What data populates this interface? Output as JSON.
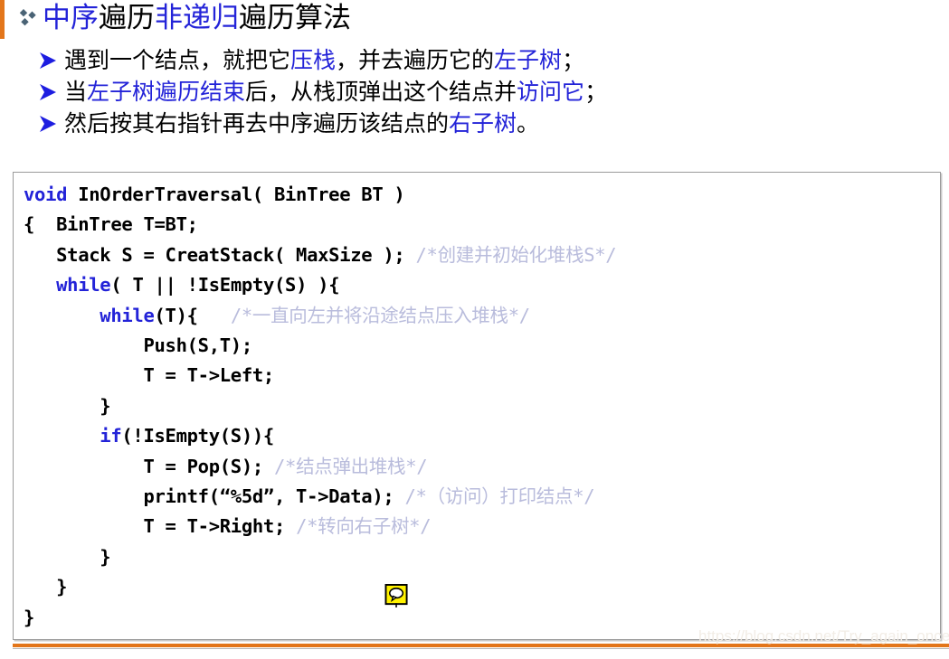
{
  "colors": {
    "accent_orange": "#E3761B",
    "highlight_blue": "#2323D8",
    "keyword_blue": "#2323D8",
    "comment_lavender": "#B9BCDC",
    "code_box_border": "#9A9A9A",
    "diamond_bullet": "#4A6375",
    "watermark": "#F2EDE6"
  },
  "heading": {
    "bullet_icon": "diamond-cluster-icon",
    "segments": [
      {
        "text": "中序",
        "highlight": true
      },
      {
        "text": "遍历",
        "highlight": false
      },
      {
        "text": "非递归",
        "highlight": true
      },
      {
        "text": "遍历算法",
        "highlight": false
      }
    ],
    "plain": "中序遍历非递归遍历算法"
  },
  "bullets": [
    {
      "icon": "arrow-bullet-icon",
      "segments": [
        {
          "text": "遇到一个结点，就把它",
          "highlight": false
        },
        {
          "text": "压栈",
          "highlight": true
        },
        {
          "text": "，并去遍历它的",
          "highlight": false
        },
        {
          "text": "左子树",
          "highlight": true
        },
        {
          "text": "；",
          "highlight": false
        }
      ],
      "plain": "遇到一个结点，就把它压栈，并去遍历它的左子树；"
    },
    {
      "icon": "arrow-bullet-icon",
      "segments": [
        {
          "text": "当",
          "highlight": false
        },
        {
          "text": "左子树遍历结束",
          "highlight": true
        },
        {
          "text": "后，从栈顶弹出这个结点并",
          "highlight": false
        },
        {
          "text": "访问它",
          "highlight": true
        },
        {
          "text": "；",
          "highlight": false
        }
      ],
      "plain": "当左子树遍历结束后，从栈顶弹出这个结点并访问它；"
    },
    {
      "icon": "arrow-bullet-icon",
      "segments": [
        {
          "text": "然后按其右指针再去中序遍历该结点的",
          "highlight": false
        },
        {
          "text": "右子树",
          "highlight": true
        },
        {
          "text": "。",
          "highlight": false
        }
      ],
      "plain": "然后按其右指针再去中序遍历该结点的右子树。"
    }
  ],
  "code_box": {
    "language": "C",
    "comment_marker": {
      "icon": "speech-bubble-comment-icon",
      "fill": "#FFF200",
      "border": "#000000"
    },
    "lines": [
      [
        {
          "t": "void",
          "c": "kw"
        },
        {
          "t": " InOrderTraversal( BinTree BT )",
          "c": ""
        }
      ],
      [
        {
          "t": "{  BinTree T=BT;",
          "c": ""
        }
      ],
      [
        {
          "t": "   Stack S = CreatStack( MaxSize ); ",
          "c": ""
        },
        {
          "t": "/*创建并初始化堆栈S*/",
          "c": "cmt"
        }
      ],
      [
        {
          "t": "   ",
          "c": ""
        },
        {
          "t": "while",
          "c": "kw"
        },
        {
          "t": "( T || !IsEmpty(S) ){",
          "c": ""
        }
      ],
      [
        {
          "t": "       ",
          "c": ""
        },
        {
          "t": "while",
          "c": "kw"
        },
        {
          "t": "(T){   ",
          "c": ""
        },
        {
          "t": "/*一直向左并将沿途结点压入堆栈*/",
          "c": "cmt"
        }
      ],
      [
        {
          "t": "           Push(S,T);",
          "c": ""
        }
      ],
      [
        {
          "t": "           T = T->Left;",
          "c": ""
        }
      ],
      [
        {
          "t": "       }",
          "c": ""
        }
      ],
      [
        {
          "t": "       ",
          "c": ""
        },
        {
          "t": "if",
          "c": "kw"
        },
        {
          "t": "(!IsEmpty(S)){",
          "c": ""
        }
      ],
      [
        {
          "t": "           T = Pop(S); ",
          "c": ""
        },
        {
          "t": "/*结点弹出堆栈*/",
          "c": "cmt"
        }
      ],
      [
        {
          "t": "           printf(“%5d”, T->Data); ",
          "c": ""
        },
        {
          "t": "/*（访问）打印结点*/",
          "c": "cmt"
        }
      ],
      [
        {
          "t": "           T = T->Right; ",
          "c": ""
        },
        {
          "t": "/*转向右子树*/",
          "c": "cmt"
        }
      ],
      [
        {
          "t": "       }",
          "c": ""
        }
      ],
      [
        {
          "t": "   }",
          "c": ""
        }
      ],
      [
        {
          "t": "}",
          "c": ""
        }
      ]
    ]
  },
  "watermark": {
    "text": "https://blog.csdn.net/Try_again_once"
  }
}
